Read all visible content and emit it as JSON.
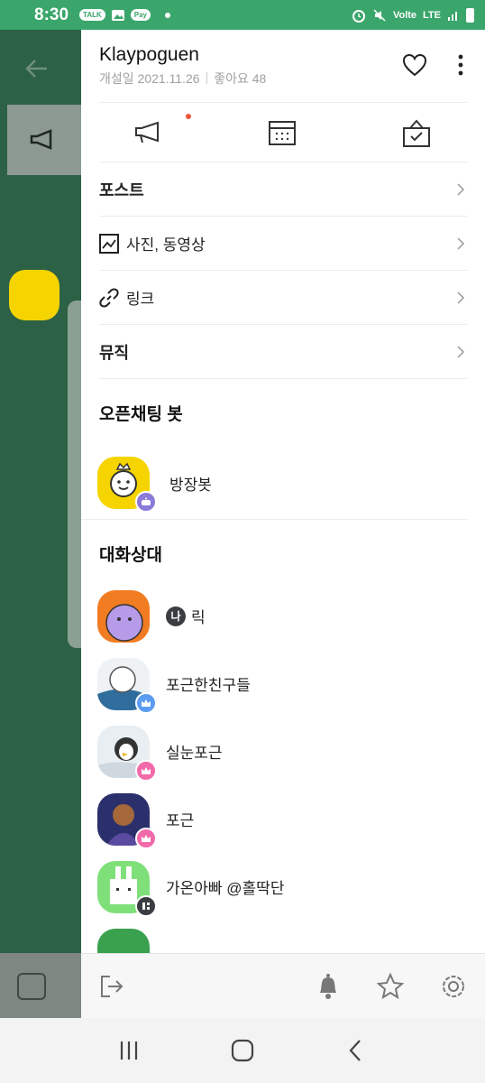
{
  "status_bar": {
    "time": "8:30",
    "notif_chips": [
      "TALK",
      "Pay"
    ],
    "network": "LTE",
    "network_sub": "Volte",
    "icons": [
      "talk-icon",
      "image-icon",
      "pay-icon",
      "alarm-icon",
      "mute-icon",
      "signal-icon",
      "battery-icon"
    ]
  },
  "drawer": {
    "title": "Klaypoguen",
    "opened_label": "개설일 2021.11.26",
    "likes_label": "좋아요 48",
    "menu": [
      {
        "label": "포스트",
        "icon": ""
      },
      {
        "label": "사진, 동영상",
        "icon": "photo-icon"
      },
      {
        "label": "링크",
        "icon": "link-icon"
      },
      {
        "label": "뮤직",
        "icon": ""
      }
    ],
    "bot_section_title": "오픈채팅 봇",
    "bot_name": "방장봇",
    "members_section_title": "대화상대",
    "me_tag": "나",
    "members": [
      {
        "name": "릭",
        "is_me": true,
        "badge": "none"
      },
      {
        "name": "포근한친구들",
        "badge": "crown-blue"
      },
      {
        "name": "실눈포근",
        "badge": "crown-pink"
      },
      {
        "name": "포근",
        "badge": "crown-pink"
      },
      {
        "name": "가온아빠 @홀딱단",
        "badge": "menu-dark"
      }
    ]
  },
  "colors": {
    "status_bar": "#3aa66b",
    "dim_background": "#2c6145",
    "notice_dot": "#f0553b",
    "host_badge": "#5b9cf0",
    "subhost_badge": "#f26aa9",
    "bot_badge": "#8b7ad8"
  }
}
